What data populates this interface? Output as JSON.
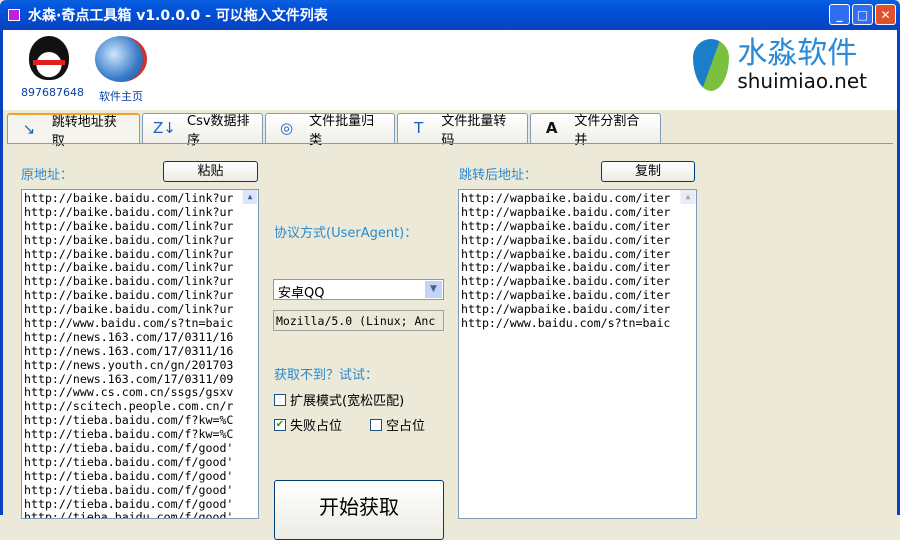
{
  "window": {
    "title": "水森·奇点工具箱 v1.0.0.0 - 可以拖入文件列表",
    "minimize": "_",
    "maximize": "□",
    "close": "✕"
  },
  "header": {
    "qq_label": "897687648",
    "home_label": "软件主页",
    "logo_cn": "水淼软件",
    "logo_en": "shuimiao.net"
  },
  "tabs": [
    {
      "label": "跳转地址获取",
      "icon": "↘"
    },
    {
      "label": "Csv数据排序",
      "icon": "Z↓"
    },
    {
      "label": "文件批量归类",
      "icon": "◎"
    },
    {
      "label": "文件批量转码",
      "icon": "T"
    },
    {
      "label": "文件分割合并",
      "icon": "A"
    }
  ],
  "main": {
    "source_label": "原地址：",
    "paste_button": "粘贴",
    "result_label": "跳转后地址：",
    "copy_button": "复制",
    "ua_label": "协议方式(UserAgent)：",
    "ua_select": "安卓QQ",
    "ua_value": "Mozilla/5.0 (Linux; Anc",
    "fallback_label": "获取不到？试试：",
    "opt_extended": "扩展模式(宽松匹配)",
    "opt_extended_checked": false,
    "opt_fail": "失败占位",
    "opt_fail_checked": true,
    "opt_empty": "空占位",
    "opt_empty_checked": false,
    "start_button": "开始获取",
    "source_lines": [
      "http://baike.baidu.com/link?ur",
      "http://baike.baidu.com/link?ur",
      "http://baike.baidu.com/link?ur",
      "http://baike.baidu.com/link?ur",
      "http://baike.baidu.com/link?ur",
      "http://baike.baidu.com/link?ur",
      "http://baike.baidu.com/link?ur",
      "http://baike.baidu.com/link?ur",
      "http://baike.baidu.com/link?ur",
      "http://www.baidu.com/s?tn=baic",
      "http://news.163.com/17/0311/16",
      "http://news.163.com/17/0311/16",
      "http://news.youth.cn/gn/201703",
      "http://news.163.com/17/0311/09",
      "http://www.cs.com.cn/ssgs/gsxv",
      "http://scitech.people.com.cn/r",
      "http://tieba.baidu.com/f?kw=%C",
      "http://tieba.baidu.com/f?kw=%C",
      "http://tieba.baidu.com/f/good'",
      "http://tieba.baidu.com/f/good'",
      "http://tieba.baidu.com/f/good'",
      "http://tieba.baidu.com/f/good'",
      "http://tieba.baidu.com/f/good'",
      "http://tieba.baidu.com/f/good'"
    ],
    "result_lines": [
      "http://wapbaike.baidu.com/iter",
      "http://wapbaike.baidu.com/iter",
      "http://wapbaike.baidu.com/iter",
      "http://wapbaike.baidu.com/iter",
      "http://wapbaike.baidu.com/iter",
      "http://wapbaike.baidu.com/iter",
      "http://wapbaike.baidu.com/iter",
      "http://wapbaike.baidu.com/iter",
      "http://wapbaike.baidu.com/iter",
      "http://www.baidu.com/s?tn=baic"
    ]
  }
}
